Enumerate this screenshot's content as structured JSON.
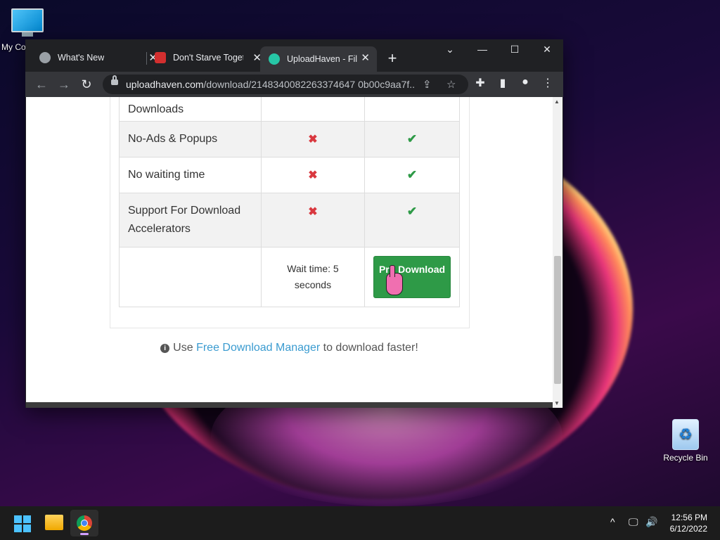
{
  "desktop": {
    "icons": [
      {
        "label": "My Co"
      },
      {
        "label": "Recycle Bin"
      }
    ]
  },
  "browser": {
    "tabs": [
      {
        "title": "What's New",
        "favicon_color": "#9aa0a6"
      },
      {
        "title": "Don't Starve Toget",
        "favicon_color": "#d32f2f"
      },
      {
        "title": "UploadHaven - Fil",
        "favicon_color": "#26c6a6",
        "active": true
      }
    ],
    "new_tab": "+",
    "window_controls": {
      "dropdown": "⌄",
      "minimize": "—",
      "maximize": "☐",
      "close": "✕"
    },
    "nav": {
      "back": "←",
      "forward": "→",
      "reload": "↻"
    },
    "address": {
      "host": "uploadhaven.com",
      "path": "/download/2148340082263374647 0b00c9aa7f..."
    },
    "toolbar_icons": {
      "share": "⇪",
      "bookmark": "☆",
      "extensions": "✚",
      "sidepanel": "▮",
      "profile": "●",
      "menu": "⋮"
    }
  },
  "comparison": {
    "rows": [
      {
        "feature": "Downloads",
        "free": "",
        "pro": ""
      },
      {
        "feature": "No-Ads & Popups",
        "free": "✖",
        "pro": "✔"
      },
      {
        "feature": "No waiting time",
        "free": "✖",
        "pro": "✔"
      },
      {
        "feature": "Support For Download Accelerators",
        "free": "✖",
        "pro": "✔"
      }
    ],
    "wait_text": "Wait time: 5 seconds",
    "pro_button": "Pro Download"
  },
  "note": {
    "prefix": "Use",
    "link": "Free Download Manager",
    "suffix": "to download faster!"
  },
  "taskbar": {
    "time": "12:56 PM",
    "date": "6/12/2022",
    "tray": {
      "chevron": "^",
      "network": "🖵",
      "volume": "🔊"
    }
  }
}
